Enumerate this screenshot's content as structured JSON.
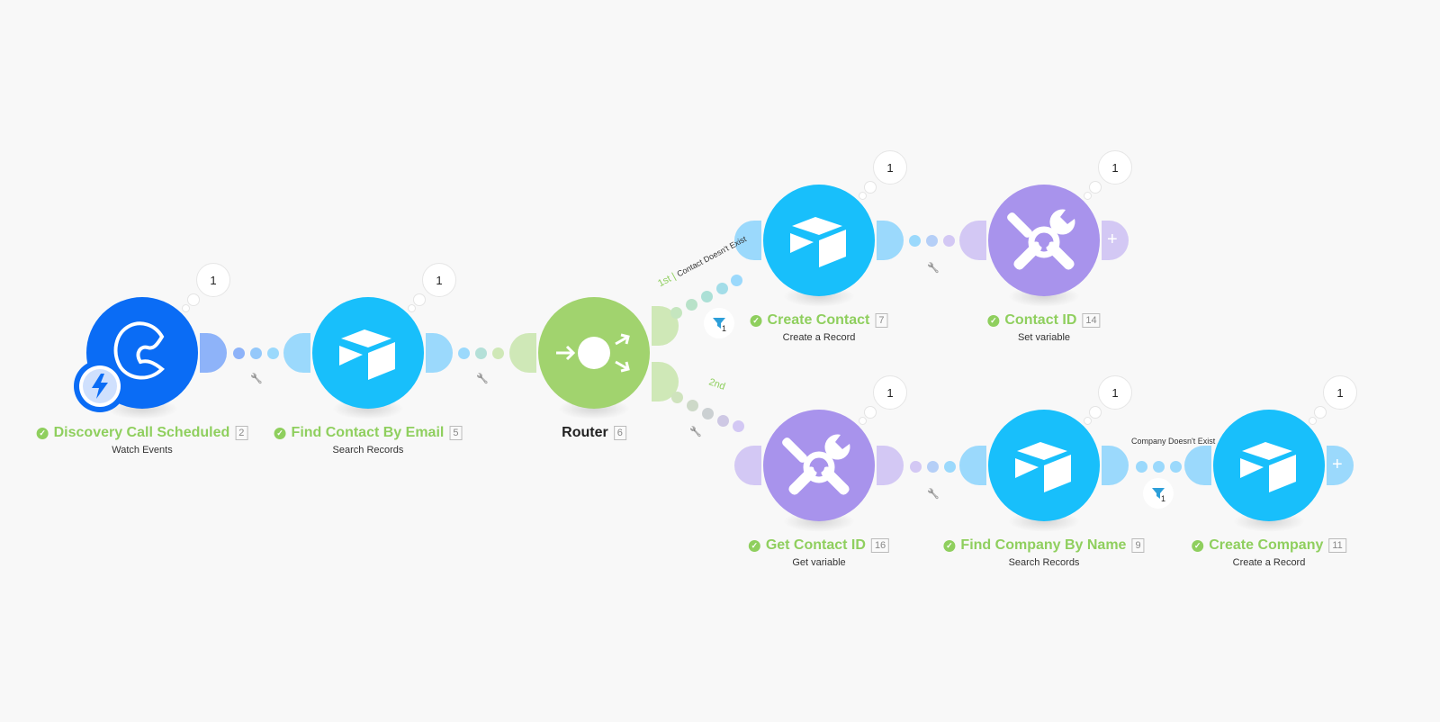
{
  "scenario": {
    "modules": [
      {
        "key": "calendly",
        "title": "Discovery Call Scheduled",
        "id": "2",
        "subtitle": "Watch Events",
        "icon": "calendly-icon",
        "color": "#0a6cf5",
        "ops": "1",
        "trigger": true
      },
      {
        "key": "find-contact",
        "title": "Find Contact By Email",
        "id": "5",
        "subtitle": "Search Records",
        "icon": "airtable-icon",
        "color": "#18bffb",
        "ops": "1"
      },
      {
        "key": "router",
        "title": "Router",
        "id": "6",
        "subtitle": "",
        "icon": "router-icon",
        "color": "#a1d36e"
      },
      {
        "key": "create-contact",
        "title": "Create Contact",
        "id": "7",
        "subtitle": "Create a Record",
        "icon": "airtable-icon",
        "color": "#18bffb",
        "ops": "1"
      },
      {
        "key": "contact-id",
        "title": "Contact ID",
        "id": "14",
        "subtitle": "Set variable",
        "icon": "tools-icon",
        "color": "#a893ec",
        "ops": "1"
      },
      {
        "key": "get-contact-id",
        "title": "Get Contact ID",
        "id": "16",
        "subtitle": "Get variable",
        "icon": "tools-icon",
        "color": "#a893ec",
        "ops": "1"
      },
      {
        "key": "find-company",
        "title": "Find Company By Name",
        "id": "9",
        "subtitle": "Search Records",
        "icon": "airtable-icon",
        "color": "#18bffb",
        "ops": "1"
      },
      {
        "key": "create-company",
        "title": "Create Company",
        "id": "11",
        "subtitle": "Create a Record",
        "icon": "airtable-icon",
        "color": "#18bffb",
        "ops": "1"
      }
    ],
    "routes": [
      {
        "order": "1st",
        "name": "Contact Doesn't Exist",
        "filter_count": "1"
      },
      {
        "order": "2nd",
        "name": ""
      }
    ],
    "filters": [
      {
        "name": "Company Doesn't Exist",
        "count": "1"
      }
    ],
    "status_colors": {
      "success": "#8fcf5e"
    }
  }
}
